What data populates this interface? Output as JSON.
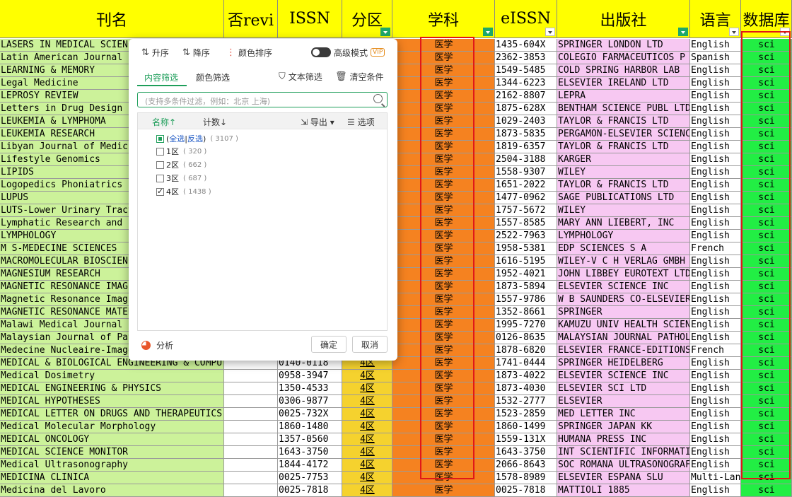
{
  "headers": {
    "name": "刊名",
    "review": "否revi",
    "issn": "ISSN",
    "zone": "分区",
    "subject": "学科",
    "eissn": "eISSN",
    "publisher": "出版社",
    "language": "语言",
    "database": "数据库"
  },
  "rows": [
    {
      "name": "LASERS IN MEDICAL SCIENCE",
      "review": "",
      "issn": "",
      "zone": "",
      "subject": "医学",
      "eissn": "1435-604X",
      "publisher": "SPRINGER LONDON LTD",
      "language": "English",
      "db": "sci"
    },
    {
      "name": "Latin American Journal",
      "review": "",
      "issn": "",
      "zone": "",
      "subject": "医学",
      "eissn": "2362-3853",
      "publisher": "COLEGIO FARMACEUTICOS P",
      "language": "Spanish",
      "db": "sci"
    },
    {
      "name": "LEARNING & MEMORY",
      "review": "",
      "issn": "",
      "zone": "",
      "subject": "医学",
      "eissn": "1549-5485",
      "publisher": "COLD SPRING HARBOR LAB",
      "language": "English",
      "db": "sci"
    },
    {
      "name": "Legal Medicine",
      "review": "",
      "issn": "",
      "zone": "",
      "subject": "医学",
      "eissn": "1344-6223",
      "publisher": "ELSEVIER IRELAND LTD",
      "language": "English",
      "db": "sci"
    },
    {
      "name": "LEPROSY REVIEW",
      "review": "",
      "issn": "",
      "zone": "",
      "subject": "医学",
      "eissn": "2162-8807",
      "publisher": "LEPRA",
      "language": "English",
      "db": "sci"
    },
    {
      "name": "Letters in Drug Design",
      "review": "",
      "issn": "",
      "zone": "",
      "subject": "医学",
      "eissn": "1875-628X",
      "publisher": "BENTHAM SCIENCE PUBL LTD",
      "language": "English",
      "db": "sci"
    },
    {
      "name": "LEUKEMIA & LYMPHOMA",
      "review": "",
      "issn": "",
      "zone": "",
      "subject": "医学",
      "eissn": "1029-2403",
      "publisher": "TAYLOR & FRANCIS LTD",
      "language": "English",
      "db": "sci"
    },
    {
      "name": "LEUKEMIA RESEARCH",
      "review": "",
      "issn": "",
      "zone": "",
      "subject": "医学",
      "eissn": "1873-5835",
      "publisher": "PERGAMON-ELSEVIER SCIENCE",
      "language": "English",
      "db": "sci"
    },
    {
      "name": "Libyan Journal of Medicine",
      "review": "",
      "issn": "",
      "zone": "",
      "subject": "医学",
      "eissn": "1819-6357",
      "publisher": "TAYLOR & FRANCIS LTD",
      "language": "English",
      "db": "sci"
    },
    {
      "name": "Lifestyle Genomics",
      "review": "",
      "issn": "",
      "zone": "",
      "subject": "医学",
      "eissn": "2504-3188",
      "publisher": "KARGER",
      "language": "English",
      "db": "sci"
    },
    {
      "name": "LIPIDS",
      "review": "",
      "issn": "",
      "zone": "",
      "subject": "医学",
      "eissn": "1558-9307",
      "publisher": "WILEY",
      "language": "English",
      "db": "sci"
    },
    {
      "name": "Logopedics Phoniatrics",
      "review": "",
      "issn": "",
      "zone": "",
      "subject": "医学",
      "eissn": "1651-2022",
      "publisher": "TAYLOR & FRANCIS LTD",
      "language": "English",
      "db": "sci"
    },
    {
      "name": "LUPUS",
      "review": "",
      "issn": "",
      "zone": "",
      "subject": "医学",
      "eissn": "1477-0962",
      "publisher": "SAGE PUBLICATIONS LTD",
      "language": "English",
      "db": "sci"
    },
    {
      "name": "LUTS-Lower Urinary Tract",
      "review": "",
      "issn": "",
      "zone": "",
      "subject": "医学",
      "eissn": "1757-5672",
      "publisher": "WILEY",
      "language": "English",
      "db": "sci"
    },
    {
      "name": "Lymphatic Research and",
      "review": "",
      "issn": "",
      "zone": "",
      "subject": "医学",
      "eissn": "1557-8585",
      "publisher": "MARY ANN LIEBERT, INC",
      "language": "English",
      "db": "sci"
    },
    {
      "name": "LYMPHOLOGY",
      "review": "",
      "issn": "",
      "zone": "",
      "subject": "医学",
      "eissn": "2522-7963",
      "publisher": "LYMPHOLOGY",
      "language": "English",
      "db": "sci"
    },
    {
      "name": "M S-MEDECINE SCIENCES",
      "review": "",
      "issn": "",
      "zone": "",
      "subject": "医学",
      "eissn": "1958-5381",
      "publisher": "EDP SCIENCES S A",
      "language": "French",
      "db": "sci"
    },
    {
      "name": "MACROMOLECULAR BIOSCIENCE",
      "review": "",
      "issn": "",
      "zone": "",
      "subject": "医学",
      "eissn": "1616-5195",
      "publisher": "WILEY-V C H VERLAG GMBH",
      "language": "English",
      "db": "sci"
    },
    {
      "name": "MAGNESIUM RESEARCH",
      "review": "",
      "issn": "",
      "zone": "",
      "subject": "医学",
      "eissn": "1952-4021",
      "publisher": "JOHN LIBBEY EUROTEXT LTD",
      "language": "English",
      "db": "sci"
    },
    {
      "name": "MAGNETIC RESONANCE IMAGING",
      "review": "",
      "issn": "",
      "zone": "",
      "subject": "医学",
      "eissn": "1873-5894",
      "publisher": "ELSEVIER SCIENCE INC",
      "language": "English",
      "db": "sci"
    },
    {
      "name": "Magnetic Resonance Imaging",
      "review": "",
      "issn": "",
      "zone": "",
      "subject": "医学",
      "eissn": "1557-9786",
      "publisher": "W B SAUNDERS CO-ELSEVIER",
      "language": "English",
      "db": "sci"
    },
    {
      "name": "MAGNETIC RESONANCE MATERIALS",
      "review": "",
      "issn": "",
      "zone": "",
      "subject": "医学",
      "eissn": "1352-8661",
      "publisher": "SPRINGER",
      "language": "English",
      "db": "sci"
    },
    {
      "name": "Malawi Medical Journal",
      "review": "",
      "issn": "",
      "zone": "",
      "subject": "医学",
      "eissn": "1995-7270",
      "publisher": "KAMUZU UNIV HEALTH SCIENCES",
      "language": "English",
      "db": "sci"
    },
    {
      "name": "Malaysian Journal of Pathology",
      "review": "",
      "issn": "",
      "zone": "",
      "subject": "医学",
      "eissn": "0126-8635",
      "publisher": "MALAYSIAN JOURNAL PATHOLOGY",
      "language": "English",
      "db": "sci"
    },
    {
      "name": "Medecine Nucleaire-Imagerie",
      "review": "",
      "issn": "",
      "zone": "",
      "subject": "医学",
      "eissn": "1878-6820",
      "publisher": "ELSEVIER FRANCE-EDITIONS",
      "language": "French",
      "db": "sci"
    },
    {
      "name": "MEDICAL & BIOLOGICAL ENGINEERING & COMPUTING",
      "review": "",
      "issn": "0140-0118",
      "zone": "4区",
      "subject": "医学",
      "eissn": "1741-0444",
      "publisher": "SPRINGER HEIDELBERG",
      "language": "English",
      "db": "sci"
    },
    {
      "name": "Medical Dosimetry",
      "review": "",
      "issn": "0958-3947",
      "zone": "4区",
      "subject": "医学",
      "eissn": "1873-4022",
      "publisher": "ELSEVIER SCIENCE INC",
      "language": "English",
      "db": "sci"
    },
    {
      "name": "MEDICAL ENGINEERING & PHYSICS",
      "review": "",
      "issn": "1350-4533",
      "zone": "4区",
      "subject": "医学",
      "eissn": "1873-4030",
      "publisher": "ELSEVIER SCI LTD",
      "language": "English",
      "db": "sci"
    },
    {
      "name": "MEDICAL HYPOTHESES",
      "review": "",
      "issn": "0306-9877",
      "zone": "4区",
      "subject": "医学",
      "eissn": "1532-2777",
      "publisher": "ELSEVIER",
      "language": "English",
      "db": "sci"
    },
    {
      "name": "MEDICAL LETTER ON DRUGS AND THERAPEUTICS",
      "review": "",
      "issn": "0025-732X",
      "zone": "4区",
      "subject": "医学",
      "eissn": "1523-2859",
      "publisher": "MED LETTER INC",
      "language": "English",
      "db": "sci"
    },
    {
      "name": "Medical Molecular Morphology",
      "review": "",
      "issn": "1860-1480",
      "zone": "4区",
      "subject": "医学",
      "eissn": "1860-1499",
      "publisher": "SPRINGER JAPAN KK",
      "language": "English",
      "db": "sci"
    },
    {
      "name": "MEDICAL ONCOLOGY",
      "review": "",
      "issn": "1357-0560",
      "zone": "4区",
      "subject": "医学",
      "eissn": "1559-131X",
      "publisher": "HUMANA PRESS INC",
      "language": "English",
      "db": "sci"
    },
    {
      "name": "MEDICAL SCIENCE MONITOR",
      "review": "",
      "issn": "1643-3750",
      "zone": "4区",
      "subject": "医学",
      "eissn": "1643-3750",
      "publisher": "INT SCIENTIFIC INFORMATION",
      "language": "English",
      "db": "sci"
    },
    {
      "name": "Medical Ultrasonography",
      "review": "",
      "issn": "1844-4172",
      "zone": "4区",
      "subject": "医学",
      "eissn": "2066-8643",
      "publisher": "SOC ROMANA ULTRASONOGRAFIE",
      "language": "English",
      "db": "sci"
    },
    {
      "name": "MEDICINA CLINICA",
      "review": "",
      "issn": "0025-7753",
      "zone": "4区",
      "subject": "医学",
      "eissn": "1578-8989",
      "publisher": "ELSEVIER ESPANA SLU",
      "language": "Multi-Language",
      "db": "sci"
    },
    {
      "name": "Medicina del Lavoro",
      "review": "",
      "issn": "0025-7818",
      "zone": "4区",
      "subject": "医学",
      "eissn": "0025-7818",
      "publisher": "MATTIOLI 1885",
      "language": "English",
      "db": "sci"
    }
  ],
  "dialog": {
    "sort_asc": "升序",
    "sort_desc": "降序",
    "color_sort": "颜色排序",
    "toggle_label": "关",
    "advanced_mode": "高级模式",
    "vip": "VIP",
    "tab_content": "内容筛选",
    "tab_color": "颜色筛选",
    "text_filter": "文本筛选",
    "clear_conditions": "清空条件",
    "search_placeholder": "(支持多条件过滤，例如：北京  上海)",
    "col_name": "名称",
    "col_count": "计数",
    "export": "导出",
    "options": "选项",
    "select_all": "全选",
    "invert": "反选",
    "total": "3107",
    "items": [
      {
        "label": "1区",
        "count": "320",
        "checked": false
      },
      {
        "label": "2区",
        "count": "662",
        "checked": false
      },
      {
        "label": "3区",
        "count": "687",
        "checked": false
      },
      {
        "label": "4区",
        "count": "1438",
        "checked": true
      }
    ],
    "analyze": "分析",
    "ok": "确定",
    "cancel": "取消"
  }
}
